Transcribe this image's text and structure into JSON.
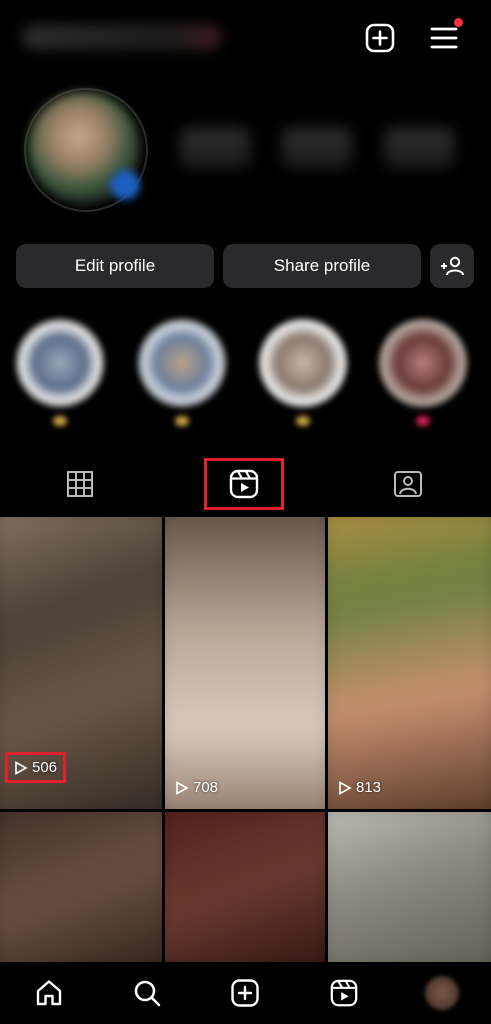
{
  "buttons": {
    "edit_profile": "Edit profile",
    "share_profile": "Share profile"
  },
  "tabs": [
    "grid",
    "reels",
    "tagged"
  ],
  "reels": [
    {
      "views": "506"
    },
    {
      "views": "708"
    },
    {
      "views": "813"
    }
  ],
  "colors": {
    "background": "#000000",
    "button": "#2a2a2c",
    "annotation": "#e0202a",
    "notification": "#ff3040"
  },
  "icons": {
    "new_post": "plus-square-icon",
    "menu": "hamburger-menu-icon",
    "add_person": "add-person-icon",
    "grid_tab": "grid-icon",
    "reels_tab": "reels-icon",
    "tagged_tab": "tagged-person-icon",
    "nav": [
      "home-icon",
      "search-icon",
      "create-icon",
      "reels-icon",
      "profile-avatar"
    ]
  }
}
